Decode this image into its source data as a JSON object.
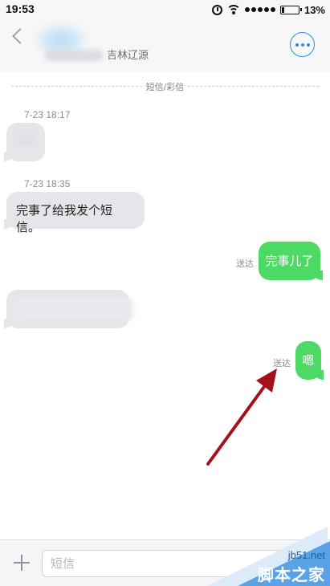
{
  "status_bar": {
    "time": "19:53",
    "battery_pct": "13%",
    "battery_level": 0.13,
    "icons": [
      "alarm-icon",
      "wifi-icon",
      "signal-icon",
      "battery-icon"
    ]
  },
  "header": {
    "carrier": "吉林辽源",
    "accent_color": "#2a8ee8"
  },
  "thread": {
    "separator_label": "短信/彩信",
    "messages": [
      {
        "timestamp": "7-23 18:17",
        "direction": "incoming",
        "text": ""
      },
      {
        "timestamp": "7-23 18:35",
        "direction": "incoming",
        "text": "完事了给我发个短信。"
      },
      {
        "direction": "outgoing",
        "text": "完事儿了",
        "status": "送达"
      },
      {
        "direction": "incoming",
        "text": ""
      },
      {
        "direction": "outgoing",
        "text": "嗯",
        "status": "送达"
      }
    ],
    "incoming_color": "#e5e5ea",
    "outgoing_color": "#4cd964"
  },
  "input_bar": {
    "placeholder": "短信"
  },
  "watermark": {
    "brand": "jb51.net",
    "name": "脚本之家"
  }
}
